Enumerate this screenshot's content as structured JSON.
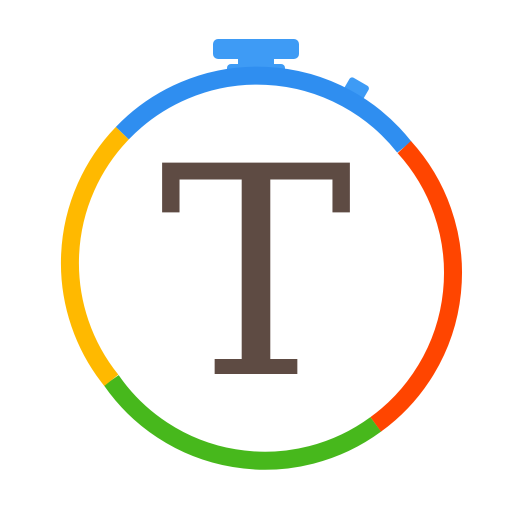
{
  "icon": {
    "letter": "T",
    "colors": {
      "blue": "#2f8ef0",
      "red": "#ff4500",
      "green": "#47b81c",
      "yellow": "#ffb900",
      "letter": "#5e4b43",
      "face": "#ffffff"
    },
    "icons": [
      "stopwatch-icon",
      "crown-button-icon",
      "side-button-icon"
    ]
  }
}
